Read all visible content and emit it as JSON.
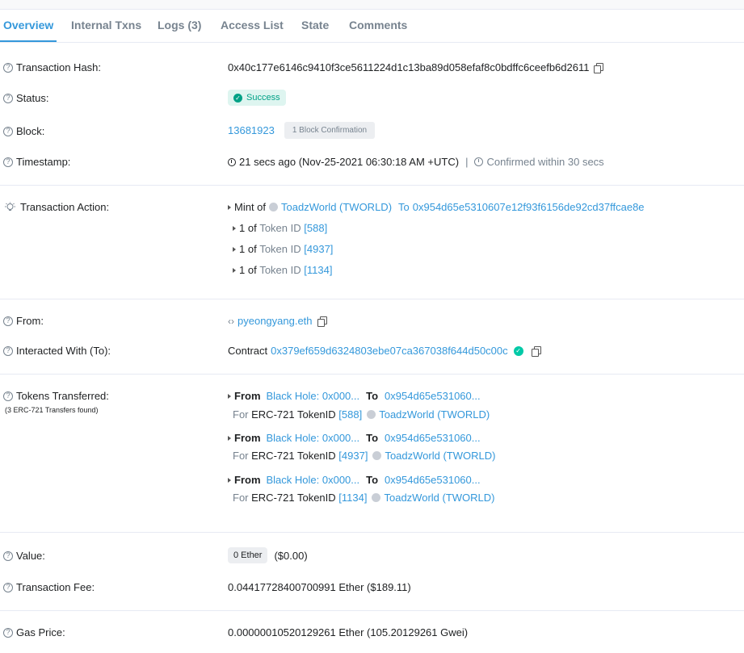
{
  "tabs": [
    {
      "label": "Overview",
      "active": true
    },
    {
      "label": "Internal Txns"
    },
    {
      "label": "Logs (3)"
    },
    {
      "label": "Access List"
    },
    {
      "label": "State"
    },
    {
      "label": "Comments"
    }
  ],
  "fields": {
    "tx_hash": {
      "label": "Transaction Hash:",
      "value": "0x40c177e6146c9410f3ce5611224d1c13ba89d058efaf8c0bdffc6ceefb6d2611"
    },
    "status": {
      "label": "Status:",
      "value": "Success"
    },
    "block": {
      "label": "Block:",
      "number": "13681923",
      "confirmations": "1 Block Confirmation"
    },
    "timestamp": {
      "label": "Timestamp:",
      "value": "21 secs ago (Nov-25-2021 06:30:18 AM +UTC)",
      "separator": "|",
      "confirmed": "Confirmed within 30 secs"
    },
    "action": {
      "label": "Transaction Action:",
      "mint_prefix": "Mint of",
      "token_name": "ToadzWorld (TWORLD)",
      "to_label": "To",
      "to_address": "0x954d65e5310607e12f93f6156de92cd37ffcae8e",
      "items": [
        {
          "qty": "1",
          "of": "of",
          "token_label": "Token ID",
          "id": "[588]"
        },
        {
          "qty": "1",
          "of": "of",
          "token_label": "Token ID",
          "id": "[4937]"
        },
        {
          "qty": "1",
          "of": "of",
          "token_label": "Token ID",
          "id": "[1134]"
        }
      ]
    },
    "from": {
      "label": "From:",
      "value": "pyeongyang.eth"
    },
    "interacted": {
      "label": "Interacted With (To):",
      "prefix": "Contract",
      "address": "0x379ef659d6324803ebe07ca367038f644d50c00c"
    },
    "tokens": {
      "label": "Tokens Transferred:",
      "sublabel": "(3 ERC-721 Transfers found)",
      "transfers": [
        {
          "from_label": "From",
          "from": "Black Hole: 0x000...",
          "to_label": "To",
          "to": "0x954d65e531060...",
          "for_label": "For",
          "type": "ERC-721 TokenID",
          "id": "[588]",
          "token": "ToadzWorld (TWORLD)"
        },
        {
          "from_label": "From",
          "from": "Black Hole: 0x000...",
          "to_label": "To",
          "to": "0x954d65e531060...",
          "for_label": "For",
          "type": "ERC-721 TokenID",
          "id": "[4937]",
          "token": "ToadzWorld (TWORLD)"
        },
        {
          "from_label": "From",
          "from": "Black Hole: 0x000...",
          "to_label": "To",
          "to": "0x954d65e531060...",
          "for_label": "For",
          "type": "ERC-721 TokenID",
          "id": "[1134]",
          "token": "ToadzWorld (TWORLD)"
        }
      ]
    },
    "value": {
      "label": "Value:",
      "ether": "0 Ether",
      "usd": "($0.00)"
    },
    "fee": {
      "label": "Transaction Fee:",
      "value": "0.04417728400700991 Ether ($189.11)"
    },
    "gas": {
      "label": "Gas Price:",
      "value": "0.000000105201292­61 Ether (105.20129261 Gwei)"
    }
  }
}
